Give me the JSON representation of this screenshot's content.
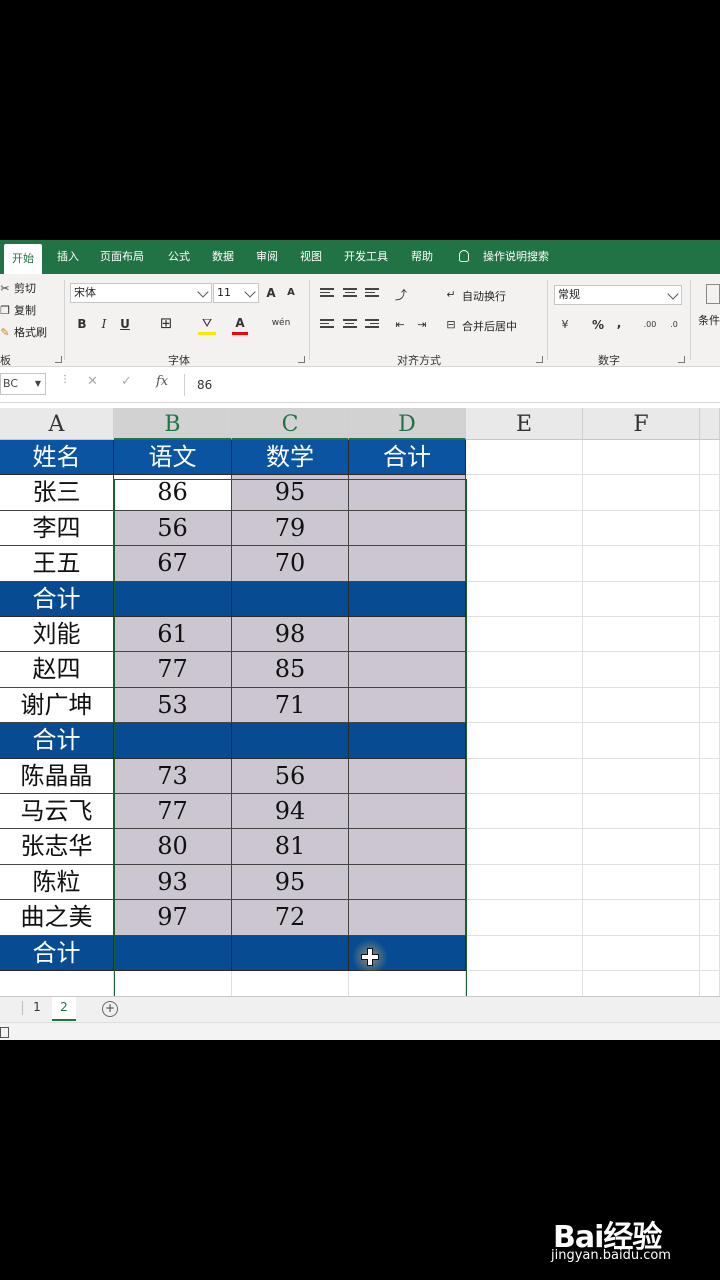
{
  "ribbon": {
    "tabs": [
      "开始",
      "插入",
      "页面布局",
      "公式",
      "数据",
      "审阅",
      "视图",
      "开发工具",
      "帮助",
      "操作说明搜索"
    ],
    "clipboard": {
      "cut": "剪切",
      "copy": "复制",
      "format_painter": "格式刷",
      "label": "板"
    },
    "font": {
      "name": "宋体",
      "size": "11",
      "label": "字体",
      "grow": "A",
      "shrink": "A",
      "bold": "B",
      "italic": "I",
      "underline": "U",
      "font_color": "A",
      "phonetic": "wén"
    },
    "alignment": {
      "wrap_text": "自动换行",
      "merge_center": "合并后居中",
      "label": "对齐方式"
    },
    "number": {
      "format": "常规",
      "label": "数字",
      "percent": "%",
      "comma": ",",
      "inc_decimal": ".00",
      "dec_decimal": ".0"
    },
    "styles": {
      "conditional": "条件"
    }
  },
  "formula_bar": {
    "name_box": "BC",
    "cancel": "✕",
    "enter": "✓",
    "fx": "fx",
    "value": "86"
  },
  "grid": {
    "columns": [
      "A",
      "B",
      "C",
      "D",
      "E",
      "F"
    ],
    "header": [
      "姓名",
      "语文",
      "数学",
      "合计"
    ],
    "rows": [
      {
        "type": "data",
        "name": "张三",
        "chinese": "86",
        "math": "95",
        "total": ""
      },
      {
        "type": "data",
        "name": "李四",
        "chinese": "56",
        "math": "79",
        "total": ""
      },
      {
        "type": "data",
        "name": "王五",
        "chinese": "67",
        "math": "70",
        "total": ""
      },
      {
        "type": "total",
        "name": "合计",
        "chinese": "",
        "math": "",
        "total": ""
      },
      {
        "type": "data",
        "name": "刘能",
        "chinese": "61",
        "math": "98",
        "total": ""
      },
      {
        "type": "data",
        "name": "赵四",
        "chinese": "77",
        "math": "85",
        "total": ""
      },
      {
        "type": "data",
        "name": "谢广坤",
        "chinese": "53",
        "math": "71",
        "total": ""
      },
      {
        "type": "total",
        "name": "合计",
        "chinese": "",
        "math": "",
        "total": ""
      },
      {
        "type": "data",
        "name": "陈晶晶",
        "chinese": "73",
        "math": "56",
        "total": ""
      },
      {
        "type": "data",
        "name": "马云飞",
        "chinese": "77",
        "math": "94",
        "total": ""
      },
      {
        "type": "data",
        "name": "张志华",
        "chinese": "80",
        "math": "81",
        "total": ""
      },
      {
        "type": "data",
        "name": "陈粒",
        "chinese": "93",
        "math": "95",
        "total": ""
      },
      {
        "type": "data",
        "name": "曲之美",
        "chinese": "97",
        "math": "72",
        "total": ""
      },
      {
        "type": "total",
        "name": "合计",
        "chinese": "",
        "math": "",
        "total": ""
      }
    ]
  },
  "sheets": {
    "tabs": [
      "1",
      "2"
    ],
    "active": "2",
    "add": "+"
  },
  "colors": {
    "ribbon_green": "#217346",
    "header_blue": "#0b54a2",
    "selection_gray": "#cbc6cf"
  },
  "watermark": {
    "logo": "Bai经验",
    "url": "jingyan.baidu.com"
  }
}
